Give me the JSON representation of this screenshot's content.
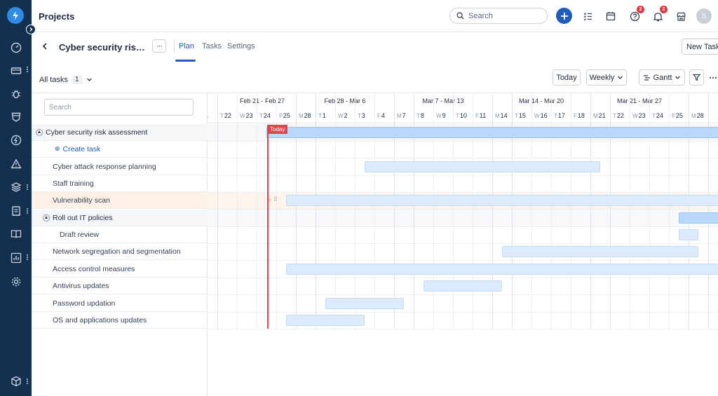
{
  "header": {
    "app_title": "Projects",
    "search_placeholder": "Search",
    "help_badge": "2",
    "notif_badge": "2",
    "avatar_initial": "S"
  },
  "project": {
    "title": "Cyber security risk ass...",
    "more_label": "···",
    "tabs": [
      {
        "label": "Plan",
        "active": true
      },
      {
        "label": "Tasks",
        "active": false
      },
      {
        "label": "Settings",
        "active": false
      }
    ],
    "new_task_label": "New Task"
  },
  "toolbar": {
    "filter_label": "All tasks",
    "filter_count": "1",
    "today_label": "Today",
    "scale_label": "Weekly",
    "view_label": "Gantt"
  },
  "task_list": {
    "search_placeholder": "Search",
    "rows": [
      {
        "label": "Cyber security risk assessment",
        "type": "group"
      },
      {
        "label": "Create task",
        "type": "create"
      },
      {
        "label": "Cyber attack response planning",
        "type": "task"
      },
      {
        "label": "Staff training",
        "type": "task"
      },
      {
        "label": "Vulnerability scan",
        "type": "task",
        "highlight": true
      },
      {
        "label": "Roll out IT policies",
        "type": "group"
      },
      {
        "label": "Draft review",
        "type": "subtask"
      },
      {
        "label": "Network segregation and segmentation",
        "type": "task"
      },
      {
        "label": "Access control measures",
        "type": "task"
      },
      {
        "label": "Antivirus updates",
        "type": "task"
      },
      {
        "label": "Password updation",
        "type": "task"
      },
      {
        "label": "OS and applications updates",
        "type": "task"
      }
    ]
  },
  "gantt": {
    "weeks": [
      "Feb 21 - Feb 27",
      "Feb 28 - Mar 6",
      "Mar 7 - Mar 13",
      "Mar 14 - Mar 20",
      "Mar 21 - Mar 27",
      "M"
    ],
    "days": [
      {
        "dw": "",
        "d": "21"
      },
      {
        "dw": "T",
        "d": "22"
      },
      {
        "dw": "W",
        "d": "23"
      },
      {
        "dw": "T",
        "d": "24"
      },
      {
        "dw": "F",
        "d": "25"
      },
      {
        "dw": "M",
        "d": "28"
      },
      {
        "dw": "T",
        "d": "1"
      },
      {
        "dw": "W",
        "d": "2"
      },
      {
        "dw": "T",
        "d": "3"
      },
      {
        "dw": "F",
        "d": "4"
      },
      {
        "dw": "M",
        "d": "7"
      },
      {
        "dw": "T",
        "d": "8"
      },
      {
        "dw": "W",
        "d": "9"
      },
      {
        "dw": "T",
        "d": "10"
      },
      {
        "dw": "F",
        "d": "11"
      },
      {
        "dw": "M",
        "d": "14"
      },
      {
        "dw": "T",
        "d": "15"
      },
      {
        "dw": "W",
        "d": "16"
      },
      {
        "dw": "T",
        "d": "17"
      },
      {
        "dw": "F",
        "d": "18"
      },
      {
        "dw": "M",
        "d": "21"
      },
      {
        "dw": "T",
        "d": "22"
      },
      {
        "dw": "W",
        "d": "23"
      },
      {
        "dw": "T",
        "d": "24"
      },
      {
        "dw": "F",
        "d": "25"
      },
      {
        "dw": "M",
        "d": "28"
      },
      {
        "dw": "",
        "d": ""
      }
    ],
    "today_label": "Today",
    "bars": [
      {
        "task": "Cyber security risk assessment",
        "start": "Feb 24",
        "end": "beyond Mar 28",
        "summary": true
      },
      {
        "task": "Cyber attack response planning",
        "start": "Mar 3",
        "end": "Mar 20"
      },
      {
        "task": "Vulnerability scan",
        "start": "Feb 25",
        "end": "beyond Mar 28"
      },
      {
        "task": "Roll out IT policies",
        "start": "Mar 25",
        "end": "beyond Mar 28",
        "summary": true
      },
      {
        "task": "Draft review",
        "start": "Mar 25",
        "end": "Mar 28"
      },
      {
        "task": "Network segregation and segmentation",
        "start": "Mar 14",
        "end": "Mar 27"
      },
      {
        "task": "Access control measures",
        "start": "Feb 25",
        "end": "beyond Mar 28"
      },
      {
        "task": "Antivirus updates",
        "start": "Mar 8",
        "end": "Mar 13"
      },
      {
        "task": "Password updation",
        "start": "Mar 1",
        "end": "Mar 6"
      },
      {
        "task": "OS and applications updates",
        "start": "Feb 25",
        "end": "Mar 3"
      }
    ]
  }
}
